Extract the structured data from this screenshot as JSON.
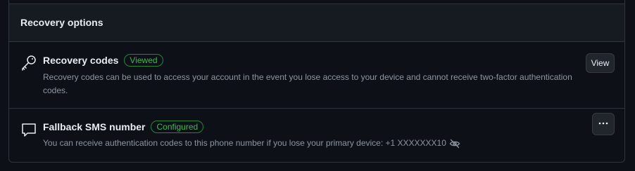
{
  "section": {
    "title": "Recovery options"
  },
  "recovery_codes": {
    "title": "Recovery codes",
    "badge": "Viewed",
    "description": "Recovery codes can be used to access your account in the event you lose access to your device and cannot receive two-factor authentication codes.",
    "button_label": "View",
    "icon": "key-icon"
  },
  "sms": {
    "title": "Fallback SMS number",
    "badge": "Configured",
    "description": "You can receive authentication codes to this phone number if you lose your primary device: +1 XXXXXXX10",
    "icon": "comment-icon",
    "reveal_icon": "eye-closed-icon",
    "menu_icon": "kebab-horizontal-icon"
  },
  "colors": {
    "background": "#0d1117",
    "header_background": "#161b22",
    "border": "#30363d",
    "badge_green": "#3fb950"
  }
}
